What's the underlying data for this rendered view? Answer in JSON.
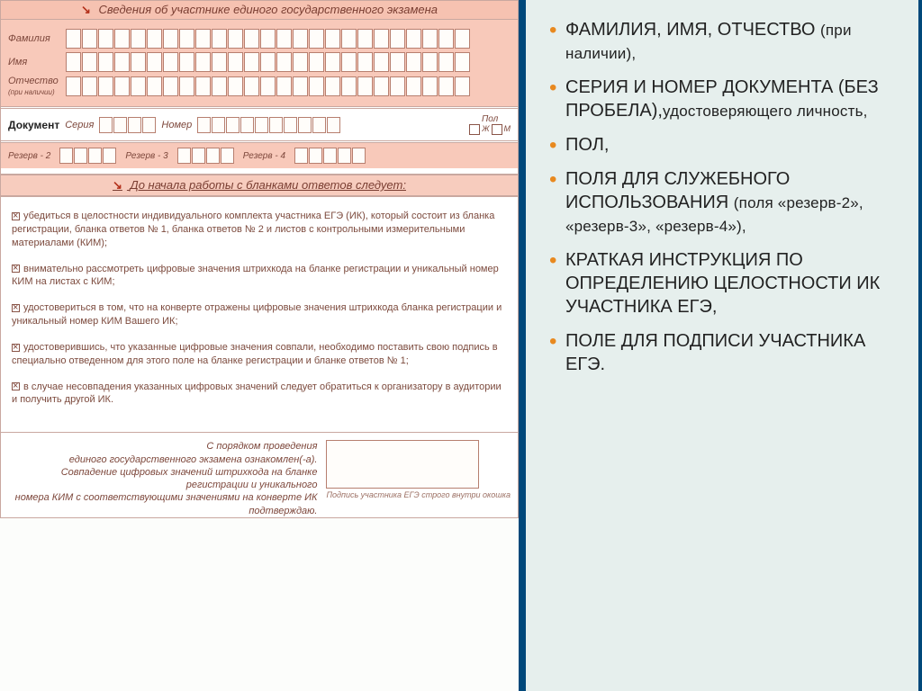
{
  "form": {
    "section_title": "Сведения об участнике единого государственного экзамена",
    "labels": {
      "surname": "Фамилия",
      "name": "Имя",
      "patronymic": "Отчество",
      "patronymic_note": "(при наличии)",
      "document": "Документ",
      "series": "Серия",
      "number": "Номер",
      "gender": "Пол",
      "g_f": "Ж",
      "g_m": "М",
      "reserve2": "Резерв - 2",
      "reserve3": "Резерв - 3",
      "reserve4": "Резерв - 4"
    },
    "instructions_header": "До начала работы с бланками ответов следует:",
    "instructions": [
      "убедиться в целостности индивидуального комплекта участника ЕГЭ (ИК), который состоит из бланка регистрации, бланка ответов № 1, бланка ответов № 2 и листов с контрольными измерительными материалами (КИМ);",
      "внимательно рассмотреть цифровые значения штрихкода на бланке регистрации и уникальный номер КИМ на листах с КИМ;",
      "удостовериться в том, что на конверте отражены цифровые значения штрихкода бланка регистрации и уникальный номер КИМ Вашего ИК;",
      "удостоверившись, что указанные цифровые значения совпали, необходимо поставить свою подпись в специально отведенном для этого поле на бланке регистрации и бланке ответов № 1;",
      "в случае несовпадения указанных цифровых значений следует обратиться к организатору в аудитории и получить другой ИК."
    ],
    "footer_lines": [
      "С порядком проведения",
      "единого государственного экзамена ознакомлен(-а).",
      "Совпадение цифровых значений штрихкода на бланке регистрации и уникального",
      "номера КИМ с соответствующими значениями на конверте ИК подтверждаю."
    ],
    "signature_caption": "Подпись участника ЕГЭ строго внутри окошка"
  },
  "bullets": [
    {
      "main": "ФАМИЛИЯ,  ИМЯ, ОТЧЕСТВО  ",
      "note": "(ПРИ  НАЛИЧИИ),"
    },
    {
      "main": "СЕРИЯ  И  НОМЕР ДОКУМЕНТА (БЕЗ ПРОБЕЛА),",
      "note": "УДОСТОВЕРЯЮЩЕГО ЛИЧНОСТЬ,"
    },
    {
      "main": "ПОЛ,"
    },
    {
      "main": "ПОЛЯ  ДЛЯ СЛУЖЕБНОГО ИСПОЛЬЗОВАНИЯ  ",
      "note": "(ПОЛЯ «РЕЗЕРВ-2», «РЕЗЕРВ-3», «РЕЗЕРВ-4»),"
    },
    {
      "main": "КРАТКАЯ ИНСТРУКЦИЯ ПО ОПРЕДЕЛЕНИЮ ЦЕЛОСТНОСТИ ИК УЧАСТНИКА ЕГЭ,"
    },
    {
      "main": "ПОЛЕ ДЛЯ ПОДПИСИ УЧАСТНИКА ЕГЭ."
    }
  ]
}
